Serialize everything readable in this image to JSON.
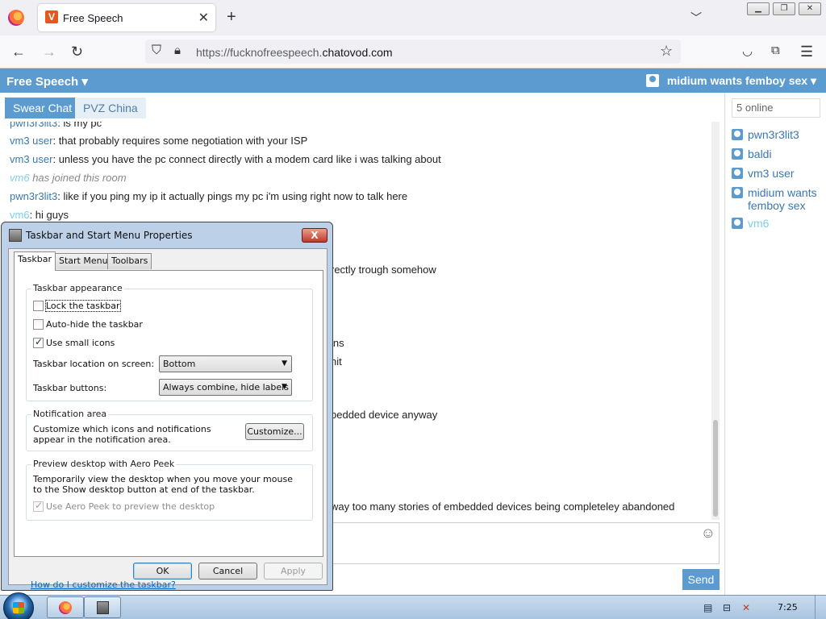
{
  "browser": {
    "tab_title": "Free Speech",
    "tab_favicon": "V",
    "new_tab": "+",
    "url_prefix": "https://fucknofreespeech.",
    "url_host": "chatovod.com"
  },
  "chat": {
    "room_menu": "Free Speech ▾",
    "user_menu": "midium wants femboy sex ▾",
    "rooms": [
      {
        "label": "Swear Chat",
        "active": true
      },
      {
        "label": "PVZ China",
        "active": false
      }
    ],
    "messages": [
      {
        "user": "pwn3r3lit3",
        "text": ": is my pc"
      },
      {
        "user": "vm3 user",
        "text": ": that probably requires some negotiation with your ISP"
      },
      {
        "user": "vm3 user",
        "text": ": unless you have the pc connect directly with a modem card like i was talking about"
      },
      {
        "user": "vm6",
        "system": "has joined this room"
      },
      {
        "user": "pwn3r3lit3",
        "text": ": like if you ping my ip it actually pings my pc i'm using right now to talk here"
      },
      {
        "user": "vm6",
        "text": ": hi guys"
      }
    ],
    "partial_lines": [
      "rectly trough somehow",
      "lns",
      "nit",
      "bedded device anyway",
      "way too many stories of embedded devices being completeley abandoned"
    ],
    "send": "Send",
    "emoji_glyph": "☺",
    "online_count": "5 online",
    "users": [
      {
        "name": "pwn3r3lit3",
        "color": "#3a78b4"
      },
      {
        "name": "baldi",
        "color": "#3a78b4"
      },
      {
        "name": "vm3 user",
        "color": "#3a78b4"
      },
      {
        "name": "midium wants femboy sex",
        "color": "#3a78b4"
      },
      {
        "name": "vm6",
        "color": "#7ecfe6"
      }
    ]
  },
  "dialog": {
    "title": "Taskbar and Start Menu Properties",
    "close": "X",
    "tabs": [
      "Taskbar",
      "Start Menu",
      "Toolbars"
    ],
    "appearance": {
      "title": "Taskbar appearance",
      "lock": {
        "label": "Lock the taskbar",
        "checked": false
      },
      "autohide": {
        "label": "Auto-hide the taskbar",
        "checked": false
      },
      "small_icons": {
        "label": "Use small icons",
        "checked": true
      },
      "location_label": "Taskbar location on screen:",
      "location_value": "Bottom",
      "buttons_label": "Taskbar buttons:",
      "buttons_value": "Always combine, hide labels"
    },
    "notification": {
      "title": "Notification area",
      "text": "Customize which icons and notifications appear in the notification area.",
      "button": "Customize..."
    },
    "peek": {
      "title": "Preview desktop with Aero Peek",
      "text": "Temporarily view the desktop when you move your mouse to the Show desktop button at end of the taskbar.",
      "checkbox": {
        "label": "Use Aero Peek to preview the desktop",
        "checked": true,
        "disabled": true
      }
    },
    "help_link": "How do I customize the taskbar?",
    "ok": "OK",
    "cancel": "Cancel",
    "apply": "Apply"
  },
  "taskbar": {
    "clock": "7:25"
  }
}
